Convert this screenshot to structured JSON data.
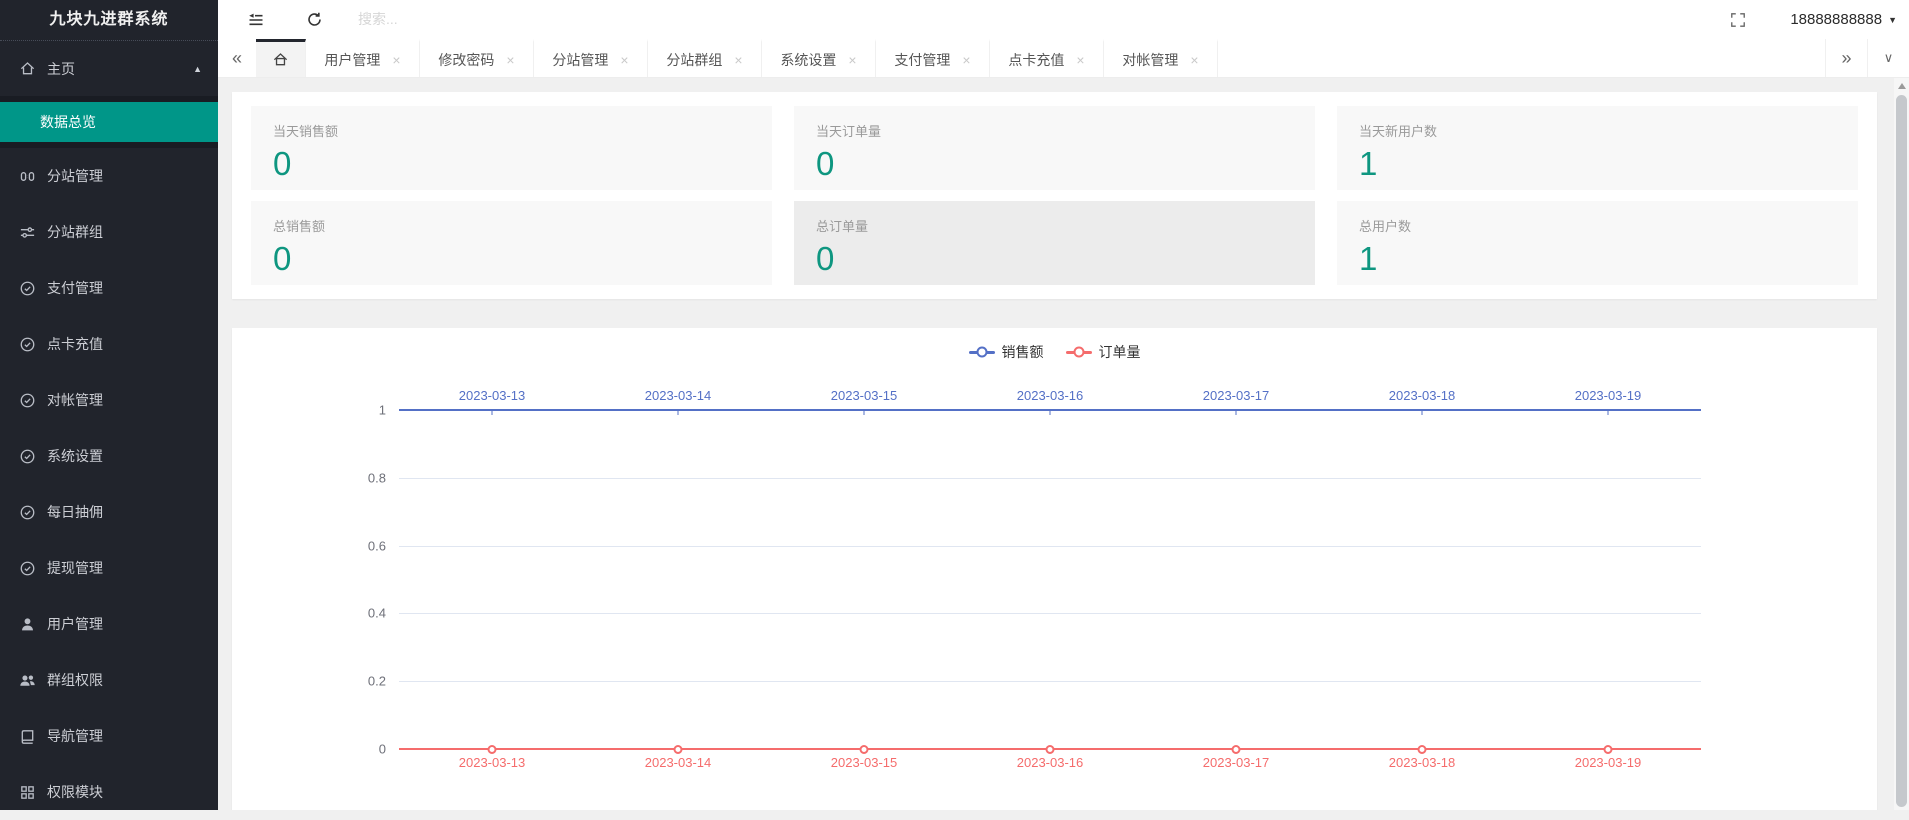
{
  "app": {
    "title": "九块九进群系统",
    "user_phone": "18888888888"
  },
  "topbar": {
    "search_placeholder": "搜索..."
  },
  "sidebar": {
    "home": {
      "label": "主页"
    },
    "active_submenu": {
      "label": "数据总览"
    },
    "items": [
      {
        "label": "分站管理"
      },
      {
        "label": "分站群组"
      },
      {
        "label": "支付管理"
      },
      {
        "label": "点卡充值"
      },
      {
        "label": "对帐管理"
      },
      {
        "label": "系统设置"
      },
      {
        "label": "每日抽佣"
      },
      {
        "label": "提现管理"
      },
      {
        "label": "用户管理"
      },
      {
        "label": "群组权限"
      },
      {
        "label": "导航管理"
      },
      {
        "label": "权限模块"
      }
    ]
  },
  "tabs": {
    "items": [
      {
        "label": "用户管理"
      },
      {
        "label": "修改密码"
      },
      {
        "label": "分站管理"
      },
      {
        "label": "分站群组"
      },
      {
        "label": "系统设置"
      },
      {
        "label": "支付管理"
      },
      {
        "label": "点卡充值"
      },
      {
        "label": "对帐管理"
      }
    ],
    "close_glyph": "×"
  },
  "stats": {
    "cards": [
      {
        "label": "当天销售额",
        "value": "0"
      },
      {
        "label": "当天订单量",
        "value": "0"
      },
      {
        "label": "当天新用户数",
        "value": "1"
      },
      {
        "label": "总销售额",
        "value": "0"
      },
      {
        "label": "总订单量",
        "value": "0"
      },
      {
        "label": "总用户数",
        "value": "1"
      }
    ]
  },
  "colors": {
    "accent": "#009688",
    "stat_value": "#0e9680",
    "sidebar_bg": "#21242c"
  },
  "chart_data": {
    "type": "line",
    "title": "",
    "categories": [
      "2023-03-13",
      "2023-03-14",
      "2023-03-15",
      "2023-03-16",
      "2023-03-17",
      "2023-03-18",
      "2023-03-19"
    ],
    "series": [
      {
        "name": "销售额",
        "color": "#5470c6",
        "axis": "top",
        "values": [
          0,
          0,
          0,
          0,
          0,
          0,
          0
        ]
      },
      {
        "name": "订单量",
        "color": "#f56c6c",
        "axis": "bottom",
        "values": [
          0,
          0,
          0,
          0,
          0,
          0,
          0
        ]
      }
    ],
    "ylim": [
      0,
      1
    ],
    "y_ticks": [
      0,
      0.2,
      0.4,
      0.6,
      0.8,
      1
    ],
    "legend_position": "top",
    "grid": "horizontal"
  }
}
